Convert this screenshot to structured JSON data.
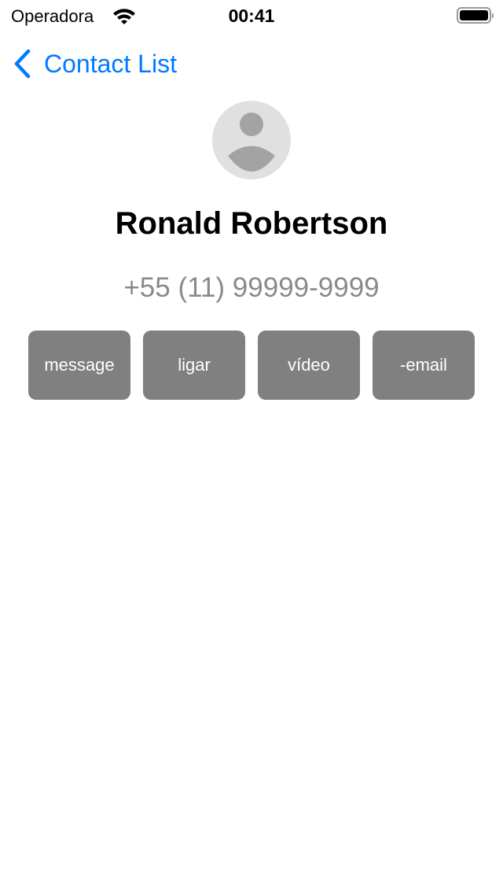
{
  "status_bar": {
    "carrier": "Operadora",
    "time": "00:41"
  },
  "nav": {
    "back_label": "Contact List"
  },
  "contact": {
    "name": "Ronald Robertson",
    "phone": "+55 (11) 99999-9999"
  },
  "actions": [
    {
      "label": "message"
    },
    {
      "label": "ligar"
    },
    {
      "label": "vídeo"
    },
    {
      "label": "-email"
    }
  ],
  "colors": {
    "accent": "#007aff",
    "button": "#808080",
    "avatar_bg": "#e0e0e0"
  }
}
